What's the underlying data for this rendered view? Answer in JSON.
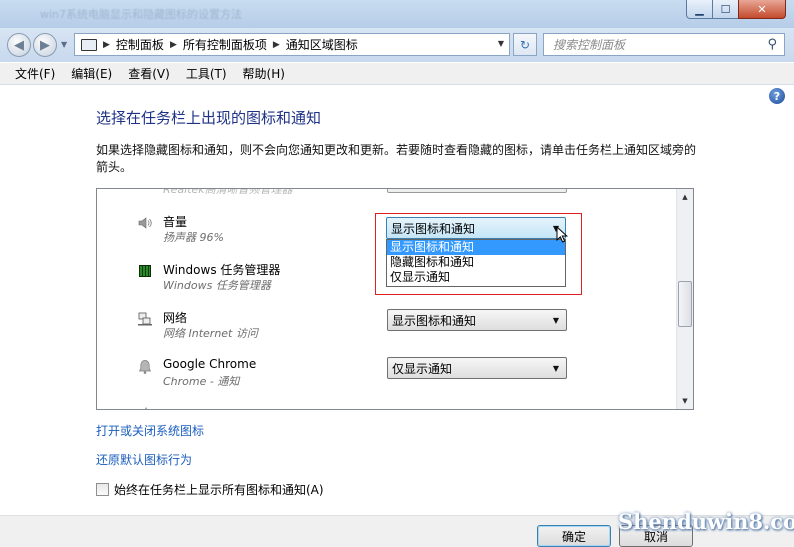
{
  "window": {
    "title_blurred": "win7系统电脑显示和隐藏图标的设置方法",
    "min_icon": "minimize-icon",
    "max_icon": "maximize-icon",
    "close_icon": "close-icon"
  },
  "addressbar": {
    "crumbs": [
      "控制面板",
      "所有控制面板项",
      "通知区域图标"
    ],
    "search_placeholder": "搜索控制面板"
  },
  "menu": [
    "文件(F)",
    "编辑(E)",
    "查看(V)",
    "工具(T)",
    "帮助(H)"
  ],
  "page": {
    "heading": "选择在任务栏上出现的图标和通知",
    "description": "如果选择隐藏图标和通知，则不会向您通知更改和更新。若要随时查看隐藏的图标，请单击任务栏上通知区域旁的箭头。"
  },
  "list": {
    "cut_top_label": "Realtek高清晰音频管理器",
    "rows": [
      {
        "name": "音量",
        "sub": "扬声器 96%",
        "icon": "speaker-icon",
        "value": "显示图标和通知"
      },
      {
        "name": "Windows 任务管理器",
        "sub": "Windows 任务管理器",
        "icon": "task-manager-icon",
        "value": ""
      },
      {
        "name": "网络",
        "sub": "网络 Internet 访问",
        "icon": "network-icon",
        "value": "显示图标和通知"
      },
      {
        "name": "Google Chrome",
        "sub": "Chrome - 通知",
        "icon": "bell-icon",
        "value": "仅显示通知"
      }
    ]
  },
  "dropdown": {
    "current": "显示图标和通知",
    "options": [
      "显示图标和通知",
      "隐藏图标和通知",
      "仅显示通知"
    ],
    "selected_index": 0
  },
  "links": {
    "system_icons": "打开或关闭系统图标",
    "restore_default": "还原默认图标行为"
  },
  "checkbox": {
    "label": "始终在任务栏上显示所有图标和通知(A)",
    "checked": false
  },
  "buttons": {
    "ok": "确定",
    "cancel": "取消"
  },
  "watermark": "Shenduwin8.com",
  "colors": {
    "heading": "#1e3287",
    "link": "#1b5ebf",
    "selection": "#3399ff",
    "highlight_box": "#e02020"
  }
}
